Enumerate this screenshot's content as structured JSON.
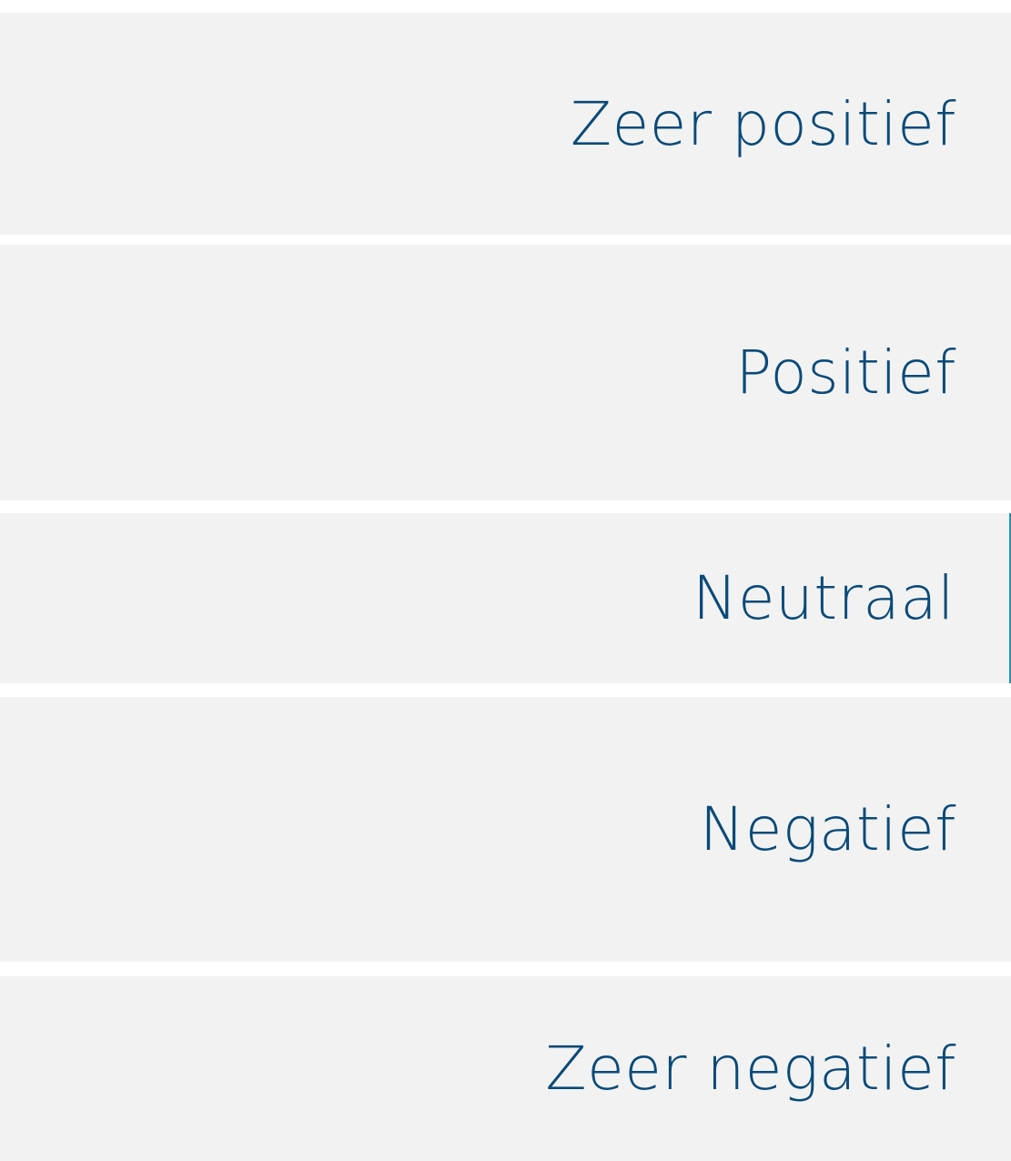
{
  "rating_options": [
    {
      "label": "Zeer positief"
    },
    {
      "label": "Positief"
    },
    {
      "label": "Neutraal"
    },
    {
      "label": "Negatief"
    },
    {
      "label": "Zeer negatief"
    }
  ],
  "colors": {
    "option_background": "#f2f2f2",
    "label_text": "#0a4a78",
    "page_background": "#ffffff",
    "focus_edge": "#2a8fb0"
  }
}
